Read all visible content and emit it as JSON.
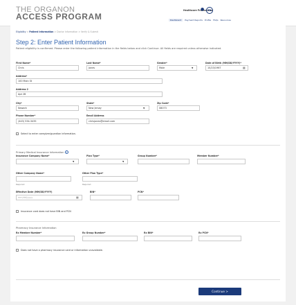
{
  "header": {
    "logo_line1": "THE ORGANON",
    "logo_line2": "ACCESS PROGRAM",
    "user_label": "Healthcare Professional",
    "help_label": "EN",
    "nav": [
      "Dashboard",
      "Payment Reports",
      "Profile",
      "FAQs",
      "Resources"
    ]
  },
  "breadcrumb": {
    "step1": "Eligibility",
    "sep": ">",
    "step2": "Patient Information",
    "step3": "Doctor Information",
    "step4": "Verify & Submit"
  },
  "page": {
    "title": "Step 2: Enter Patient Information",
    "description": "Patient eligibility is confirmed. Please enter the following patient information in the fields below and click Continue. All fields are required unless otherwise indicated."
  },
  "patient": {
    "first_name_label": "First Name*",
    "first_name": "Chris",
    "last_name_label": "Last Name*",
    "last_name": "Jones",
    "gender_label": "Gender*",
    "gender": "Male",
    "dob_label": "Date of Birth (MM/DD/YYYY)*",
    "dob": "10/23/1967",
    "address_label": "Address*",
    "address": "100 Main St",
    "address2_label": "Address 2",
    "address2": "Apt 2B",
    "city_label": "City*",
    "city": "Newark",
    "state_label": "State*",
    "state": "New Jersey",
    "zip_label": "Zip Code*",
    "zip": "08073",
    "phone_label": "Phone Number*",
    "phone": "(443) 534-3435",
    "email_label": "Email Address",
    "email": "chrisjones@email.com",
    "caregiver_checkbox": "Select to enter caregiver/guardian information."
  },
  "medical": {
    "section_title": "Primary Medical Insurance Information",
    "info_icon": "?",
    "company_label": "Insurance Company Name*",
    "plan_type_label": "Plan Type*",
    "group_label": "Group Number*",
    "member_label": "Member Number*",
    "other_company_label": "Other Company Name*",
    "other_plan_label": "Other Plan Type*",
    "required_hint_1": "Required",
    "required_hint_2": "Required",
    "effective_date_label": "Effective Date (MM/DD/YYYY)",
    "effective_date_placeholder": "mm/dd/yyyy",
    "bin_label": "BIN*",
    "pcn_label": "PCN*",
    "no_bin_checkbox": "Insurance card does not have BIN and PCN"
  },
  "pharmacy": {
    "section_title": "Pharmacy Insurance Information",
    "member_label": "Rx Member Number*",
    "group_label": "Rx Group Number*",
    "bin_label": "Rx BIN*",
    "pcn_label": "Rx PCN*",
    "no_card_checkbox": "Does not have a pharmacy insurance card or information unavailable."
  },
  "actions": {
    "continue_label": "Continue  >"
  }
}
